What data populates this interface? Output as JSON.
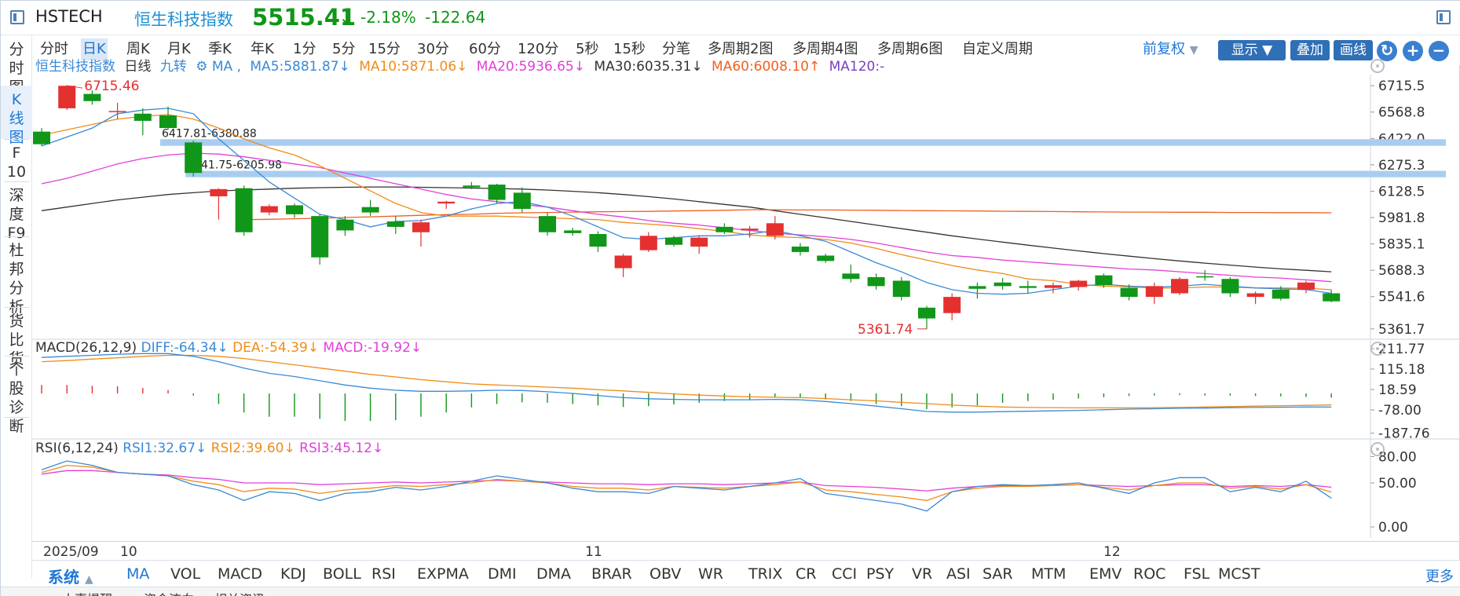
{
  "header": {
    "symbol": "HSTECH",
    "name": "恒生科技指数",
    "price": "5515.41",
    "price_arrow": "↓",
    "change_pct": "-2.18%",
    "change_abs": "-122.64"
  },
  "left_tabs": [
    {
      "label": "分\n时\n图"
    },
    {
      "label": "K\n线\n图"
    },
    {
      "label": "F\n10"
    },
    {
      "label": "深\n度\nF9"
    },
    {
      "label": "杜\n邦\n分\n析"
    },
    {
      "label": "货\n比\n货"
    },
    {
      "label": "个\n股\n诊\n断"
    }
  ],
  "periods": [
    "分时",
    "日K",
    "周K",
    "月K",
    "季K",
    "年K",
    "1分",
    "5分",
    "15分",
    "30分",
    "60分",
    "120分",
    "5秒",
    "15秒",
    "分笔",
    "多周期2图",
    "多周期4图",
    "多周期6图",
    "自定义周期"
  ],
  "toolbar": {
    "adjust": "前复权",
    "show": "显示",
    "overlay": "叠加",
    "draw": "画线",
    "refresh_icon": "refresh-icon",
    "zoom_in": "+",
    "zoom_out": "−"
  },
  "main_legend": {
    "name": "恒生科技指数",
    "period": "日线",
    "nine": "九转",
    "ma_prefix": "MA ,",
    "ma5": "MA5:5881.87↓",
    "ma10": "MA10:5871.06↓",
    "ma20": "MA20:5936.65↓",
    "ma30": "MA30:6035.31↓",
    "ma60": "MA60:6008.10↑",
    "ma120": "MA120:-"
  },
  "colors": {
    "up": "#e53030",
    "down": "#109618",
    "ma5": "#3a8ad6",
    "ma10": "#f08c18",
    "ma20": "#e040d8",
    "ma30": "#333333",
    "ma60": "#f06020",
    "ma120": "#7a40c0",
    "zone": "#a8cdf0"
  },
  "price_axis": [
    "6715.5",
    "6568.8",
    "6422.0",
    "6275.3",
    "6128.5",
    "5981.8",
    "5835.1",
    "5688.3",
    "5541.6",
    "5361.7"
  ],
  "annotations": {
    "high": "6715.46",
    "low": "5361.74",
    "zone1": "6417.81-6380.88",
    "zone2": "6241.75-6205.98"
  },
  "macd_legend": {
    "name": "MACD(26,12,9)",
    "diff": "DIFF:-64.34↓",
    "dea": "DEA:-54.39↓",
    "macd": "MACD:-19.92↓"
  },
  "macd_axis": [
    "211.77",
    "115.18",
    "18.59",
    "-78.00",
    "-187.76"
  ],
  "rsi_legend": {
    "name": "RSI(6,12,24)",
    "rsi1": "RSI1:32.67↓",
    "rsi2": "RSI2:39.60↓",
    "rsi3": "RSI3:45.12↓"
  },
  "rsi_axis": [
    "80.00",
    "50.00",
    "0.00"
  ],
  "date_labels": [
    "2025/09",
    "10",
    "11",
    "12"
  ],
  "indicator_tabs": {
    "system": "系统",
    "tabs": [
      "MA",
      "VOL",
      "MACD",
      "KDJ",
      "BOLL",
      "RSI",
      "EXPMA",
      "DMI",
      "DMA",
      "BRAR",
      "OBV",
      "WR",
      "TRIX",
      "CR",
      "CCI",
      "PSY",
      "VR",
      "ASI",
      "SAR",
      "MTM",
      "EMV",
      "ROC",
      "FSL",
      "MCST"
    ],
    "more": "更多"
  },
  "bottom_strip": [
    "大事提醒",
    "资金流向",
    "相关资讯"
  ],
  "chart_data": {
    "type": "candlestick",
    "title": "恒生科技指数 日线",
    "ylim": [
      5300,
      6760
    ],
    "candles": [
      {
        "o": 6460,
        "h": 6480,
        "l": 6380,
        "c": 6390
      },
      {
        "o": 6590,
        "h": 6720,
        "l": 6580,
        "c": 6715
      },
      {
        "o": 6670,
        "h": 6690,
        "l": 6610,
        "c": 6630
      },
      {
        "o": 6570,
        "h": 6620,
        "l": 6530,
        "c": 6575
      },
      {
        "o": 6560,
        "h": 6590,
        "l": 6440,
        "c": 6520
      },
      {
        "o": 6550,
        "h": 6600,
        "l": 6470,
        "c": 6480
      },
      {
        "o": 6400,
        "h": 6410,
        "l": 6210,
        "c": 6230
      },
      {
        "o": 6100,
        "h": 6145,
        "l": 5970,
        "c": 6140
      },
      {
        "o": 6145,
        "h": 6160,
        "l": 5880,
        "c": 5900
      },
      {
        "o": 6010,
        "h": 6055,
        "l": 5995,
        "c": 6045
      },
      {
        "o": 6050,
        "h": 6060,
        "l": 5980,
        "c": 6000
      },
      {
        "o": 5990,
        "h": 6000,
        "l": 5720,
        "c": 5760
      },
      {
        "o": 5970,
        "h": 5990,
        "l": 5880,
        "c": 5910
      },
      {
        "o": 6040,
        "h": 6080,
        "l": 5990,
        "c": 6010
      },
      {
        "o": 5960,
        "h": 5990,
        "l": 5890,
        "c": 5930
      },
      {
        "o": 5900,
        "h": 5970,
        "l": 5820,
        "c": 5955
      },
      {
        "o": 6060,
        "h": 6075,
        "l": 6030,
        "c": 6070
      },
      {
        "o": 6160,
        "h": 6180,
        "l": 6140,
        "c": 6150
      },
      {
        "o": 6165,
        "h": 6170,
        "l": 6060,
        "c": 6080
      },
      {
        "o": 6120,
        "h": 6150,
        "l": 6010,
        "c": 6030
      },
      {
        "o": 5990,
        "h": 6010,
        "l": 5880,
        "c": 5900
      },
      {
        "o": 5910,
        "h": 5925,
        "l": 5880,
        "c": 5895
      },
      {
        "o": 5890,
        "h": 5905,
        "l": 5790,
        "c": 5820
      },
      {
        "o": 5700,
        "h": 5780,
        "l": 5650,
        "c": 5770
      },
      {
        "o": 5800,
        "h": 5900,
        "l": 5790,
        "c": 5880
      },
      {
        "o": 5870,
        "h": 5880,
        "l": 5820,
        "c": 5830
      },
      {
        "o": 5820,
        "h": 5880,
        "l": 5780,
        "c": 5870
      },
      {
        "o": 5930,
        "h": 5950,
        "l": 5890,
        "c": 5900
      },
      {
        "o": 5910,
        "h": 5935,
        "l": 5870,
        "c": 5920
      },
      {
        "o": 5880,
        "h": 5990,
        "l": 5860,
        "c": 5950
      },
      {
        "o": 5820,
        "h": 5840,
        "l": 5770,
        "c": 5790
      },
      {
        "o": 5770,
        "h": 5780,
        "l": 5730,
        "c": 5740
      },
      {
        "o": 5670,
        "h": 5720,
        "l": 5620,
        "c": 5640
      },
      {
        "o": 5650,
        "h": 5670,
        "l": 5580,
        "c": 5600
      },
      {
        "o": 5630,
        "h": 5650,
        "l": 5520,
        "c": 5540
      },
      {
        "o": 5480,
        "h": 5490,
        "l": 5361.74,
        "c": 5420
      },
      {
        "o": 5450,
        "h": 5560,
        "l": 5410,
        "c": 5540
      },
      {
        "o": 5600,
        "h": 5620,
        "l": 5530,
        "c": 5585
      },
      {
        "o": 5620,
        "h": 5645,
        "l": 5580,
        "c": 5600
      },
      {
        "o": 5600,
        "h": 5630,
        "l": 5560,
        "c": 5590
      },
      {
        "o": 5590,
        "h": 5620,
        "l": 5560,
        "c": 5605
      },
      {
        "o": 5595,
        "h": 5635,
        "l": 5575,
        "c": 5630
      },
      {
        "o": 5660,
        "h": 5670,
        "l": 5590,
        "c": 5605
      },
      {
        "o": 5590,
        "h": 5610,
        "l": 5520,
        "c": 5540
      },
      {
        "o": 5540,
        "h": 5620,
        "l": 5500,
        "c": 5600
      },
      {
        "o": 5560,
        "h": 5650,
        "l": 5550,
        "c": 5640
      },
      {
        "o": 5655,
        "h": 5690,
        "l": 5630,
        "c": 5650
      },
      {
        "o": 5640,
        "h": 5650,
        "l": 5540,
        "c": 5560
      },
      {
        "o": 5540,
        "h": 5570,
        "l": 5500,
        "c": 5560
      },
      {
        "o": 5580,
        "h": 5600,
        "l": 5520,
        "c": 5530
      },
      {
        "o": 5580,
        "h": 5630,
        "l": 5560,
        "c": 5620
      },
      {
        "o": 5560,
        "h": 5580,
        "l": 5510,
        "c": 5515.41
      }
    ],
    "ma5": [
      6380,
      6430,
      6480,
      6560,
      6580,
      6590,
      6560,
      6420,
      6300,
      6180,
      6090,
      6000,
      5970,
      5930,
      5960,
      5965,
      5990,
      6030,
      6060,
      6070,
      6040,
      5990,
      5930,
      5870,
      5860,
      5870,
      5880,
      5880,
      5890,
      5910,
      5880,
      5850,
      5790,
      5730,
      5680,
      5620,
      5580,
      5560,
      5555,
      5560,
      5580,
      5600,
      5610,
      5600,
      5595,
      5600,
      5610,
      5600,
      5590,
      5585,
      5580,
      5560
    ],
    "ma10": [
      6440,
      6470,
      6500,
      6530,
      6545,
      6555,
      6530,
      6480,
      6420,
      6370,
      6330,
      6270,
      6200,
      6130,
      6060,
      6010,
      5990,
      5990,
      5990,
      5985,
      5980,
      5975,
      5970,
      5955,
      5945,
      5935,
      5920,
      5905,
      5885,
      5875,
      5870,
      5860,
      5840,
      5810,
      5775,
      5745,
      5715,
      5690,
      5670,
      5640,
      5630,
      5610,
      5600,
      5595,
      5590,
      5590,
      5595,
      5595,
      5590,
      5590,
      5588,
      5580
    ],
    "ma20": [
      6170,
      6200,
      6240,
      6280,
      6310,
      6330,
      6340,
      6335,
      6320,
      6300,
      6280,
      6260,
      6230,
      6200,
      6170,
      6140,
      6110,
      6085,
      6070,
      6055,
      6040,
      6020,
      6000,
      5985,
      5965,
      5950,
      5940,
      5925,
      5910,
      5895,
      5885,
      5875,
      5860,
      5840,
      5815,
      5790,
      5770,
      5760,
      5745,
      5735,
      5725,
      5715,
      5705,
      5695,
      5690,
      5680,
      5670,
      5660,
      5650,
      5645,
      5635,
      5625
    ],
    "ma30": [
      6020,
      6040,
      6060,
      6080,
      6095,
      6110,
      6120,
      6130,
      6135,
      6140,
      6145,
      6148,
      6150,
      6152,
      6152,
      6150,
      6148,
      6146,
      6143,
      6140,
      6135,
      6128,
      6120,
      6110,
      6098,
      6085,
      6070,
      6055,
      6040,
      6020,
      6000,
      5980,
      5960,
      5940,
      5920,
      5900,
      5880,
      5862,
      5845,
      5828,
      5812,
      5796,
      5781,
      5767,
      5753,
      5740,
      5728,
      5717,
      5706,
      5696,
      5688,
      5680
    ],
    "ma60": [
      null,
      null,
      null,
      null,
      null,
      null,
      null,
      null,
      5970,
      5972,
      5975,
      5978,
      5982,
      5986,
      5990,
      5994,
      5998,
      6000,
      6005,
      6008,
      6010,
      6012,
      6014,
      6015,
      6016,
      6018,
      6020,
      6022,
      6025,
      6025,
      6024,
      6024,
      6023,
      6022,
      6021,
      6020,
      6019,
      6018,
      6017,
      6016,
      6015,
      6014,
      6013,
      6012,
      6012,
      6011,
      6011,
      6010,
      6010,
      6009,
      6009,
      6008
    ],
    "macd": {
      "diff": [
        170,
        175,
        180,
        185,
        188,
        188,
        175,
        150,
        120,
        95,
        80,
        60,
        40,
        25,
        15,
        10,
        10,
        12,
        15,
        14,
        8,
        0,
        -10,
        -20,
        -25,
        -28,
        -30,
        -30,
        -30,
        -28,
        -30,
        -38,
        -48,
        -60,
        -72,
        -85,
        -88,
        -88,
        -86,
        -84,
        -82,
        -80,
        -77,
        -74,
        -72,
        -70,
        -69,
        -67,
        -66,
        -65,
        -64,
        -64.34
      ],
      "dea": [
        150,
        155,
        162,
        168,
        175,
        180,
        180,
        175,
        165,
        150,
        135,
        120,
        105,
        90,
        78,
        65,
        55,
        45,
        40,
        35,
        30,
        25,
        18,
        12,
        5,
        -2,
        -8,
        -12,
        -16,
        -18,
        -20,
        -24,
        -30,
        -35,
        -42,
        -48,
        -55,
        -60,
        -64,
        -66,
        -67,
        -68,
        -68,
        -68,
        -67,
        -66,
        -64,
        -62,
        -60,
        -58,
        -56,
        -54.39
      ],
      "bar": [
        40,
        40,
        36,
        34,
        26,
        16,
        -10,
        -50,
        -90,
        -110,
        -110,
        -120,
        -130,
        -130,
        -126,
        -110,
        -90,
        -66,
        -50,
        -42,
        -44,
        -50,
        -56,
        -64,
        -60,
        -52,
        -44,
        -36,
        -28,
        -20,
        -20,
        -28,
        -36,
        -50,
        -60,
        -74,
        -66,
        -56,
        -44,
        -36,
        -30,
        -24,
        -18,
        -12,
        -10,
        -8,
        -10,
        -10,
        -12,
        -14,
        -16,
        -19.92
      ]
    },
    "rsi": {
      "rsi1": [
        65,
        75,
        70,
        62,
        60,
        58,
        48,
        42,
        30,
        40,
        38,
        30,
        38,
        40,
        45,
        42,
        46,
        52,
        58,
        54,
        50,
        44,
        40,
        40,
        38,
        46,
        44,
        42,
        46,
        50,
        55,
        38,
        34,
        30,
        26,
        18,
        40,
        46,
        48,
        47,
        48,
        50,
        44,
        38,
        50,
        56,
        56,
        40,
        45,
        40,
        52,
        32.67
      ],
      "rsi2": [
        62,
        70,
        68,
        62,
        60,
        58,
        52,
        48,
        40,
        44,
        43,
        38,
        42,
        44,
        47,
        46,
        48,
        50,
        54,
        52,
        50,
        46,
        44,
        44,
        42,
        46,
        45,
        44,
        46,
        48,
        51,
        42,
        40,
        37,
        34,
        30,
        40,
        44,
        46,
        46,
        47,
        48,
        45,
        42,
        47,
        50,
        50,
        44,
        46,
        43,
        48,
        39.6
      ],
      "rsi3": [
        60,
        64,
        64,
        62,
        60,
        59,
        56,
        54,
        50,
        50,
        50,
        48,
        49,
        50,
        51,
        50,
        51,
        52,
        53,
        52,
        51,
        50,
        49,
        49,
        48,
        49,
        49,
        48,
        49,
        50,
        51,
        47,
        46,
        45,
        43,
        41,
        44,
        46,
        47,
        47,
        47,
        48,
        47,
        46,
        47,
        48,
        48,
        46,
        47,
        46,
        48,
        45.12
      ]
    }
  }
}
